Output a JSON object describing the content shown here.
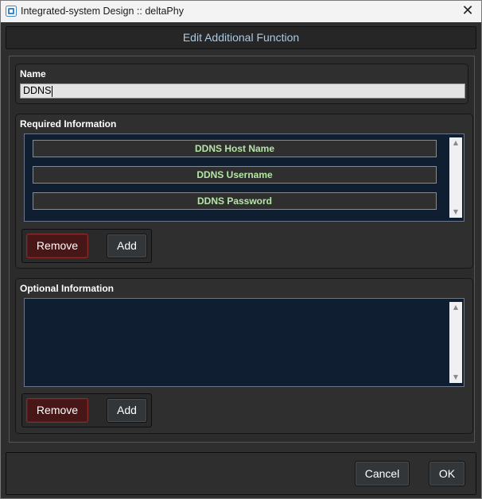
{
  "window": {
    "title": "Integrated-system Design :: deltaPhy",
    "close_glyph": "✕"
  },
  "dialog": {
    "header": "Edit Additional Function"
  },
  "name_section": {
    "label": "Name",
    "value": "DDNS"
  },
  "required_section": {
    "label": "Required Information",
    "items": [
      "DDNS Host Name",
      "DDNS Username",
      "DDNS Password"
    ],
    "remove_label": "Remove",
    "add_label": "Add"
  },
  "optional_section": {
    "label": "Optional Information",
    "items": [],
    "remove_label": "Remove",
    "add_label": "Add"
  },
  "footer": {
    "cancel_label": "Cancel",
    "ok_label": "OK"
  },
  "icons": {
    "scroll_up": "▲",
    "scroll_down": "▼"
  },
  "colors": {
    "list_bg": "#0f1e30",
    "item_text": "#b6e6a6",
    "header_text": "#a9cbe3",
    "remove_bg": "#471617"
  }
}
